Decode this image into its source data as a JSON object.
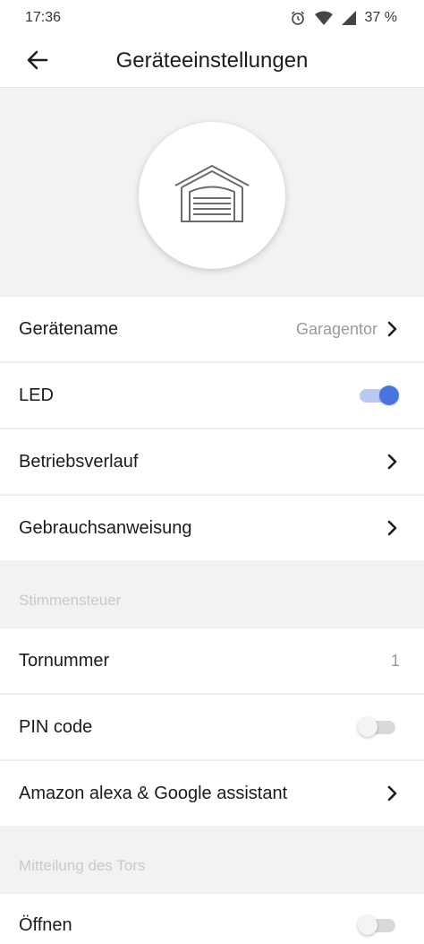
{
  "status_bar": {
    "time": "17:36",
    "battery": "37 %",
    "icons": [
      "alarm-icon",
      "wifi-icon",
      "signal-icon"
    ]
  },
  "app_bar": {
    "title": "Geräteeinstellungen",
    "back_icon": "arrow-left-icon"
  },
  "device": {
    "icon": "garage-door-icon"
  },
  "settings": {
    "device_name": {
      "label": "Gerätename",
      "value": "Garagentor"
    },
    "led": {
      "label": "LED",
      "enabled": true
    },
    "history": {
      "label": "Betriebsverlauf"
    },
    "manual": {
      "label": "Gebrauchsanweisung"
    }
  },
  "voice_section": {
    "header": "Stimmensteuer",
    "gate_number": {
      "label": "Tornummer",
      "value": "1"
    },
    "pin_code": {
      "label": "PIN code",
      "enabled": false
    },
    "assistants": {
      "label": "Amazon alexa & Google assistant"
    }
  },
  "notification_section": {
    "header": "Mitteilung des Tors",
    "open": {
      "label": "Öffnen",
      "enabled": false
    }
  },
  "colors": {
    "accent": "#4b73dc",
    "accent_track": "#b9c9f2",
    "background": "#f2f2f2",
    "muted_text": "#9a9a9a",
    "section_text": "#c9c9c9"
  }
}
